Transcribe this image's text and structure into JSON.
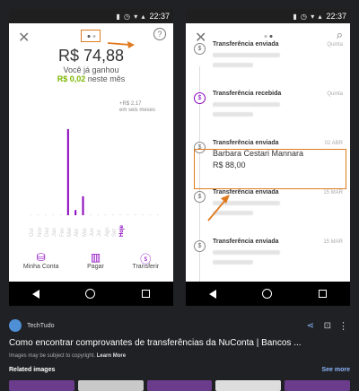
{
  "left_screen": {
    "status_time": "22:37",
    "balance": "R$ 74,88",
    "earned_line1": "Você já ganhou",
    "earned_amount": "R$ 0,02",
    "earned_line2": "neste mês",
    "chart_note": "+R$ 2,17",
    "chart_note2": "em seis meses",
    "months": [
      "Out",
      "Nov",
      "Dez",
      "Jan",
      "Fev",
      "Mar",
      "Abr",
      "Mai",
      "Jun",
      "Jul",
      "Ago",
      "Set",
      "Hoje",
      "",
      "",
      "",
      "",
      ""
    ],
    "current_month_label": "Hoje",
    "actions": [
      {
        "label": "Minha Conta",
        "icon": "account-icon"
      },
      {
        "label": "Pagar",
        "icon": "barcode-icon"
      },
      {
        "label": "Transferir",
        "icon": "transfer-icon"
      }
    ]
  },
  "right_screen": {
    "status_time": "22:37",
    "transactions": [
      {
        "title": "Transferência enviada",
        "date": "Quinta",
        "type": "sent"
      },
      {
        "title": "Transferência recebida",
        "date": "Quinta",
        "type": "received"
      },
      {
        "title": "Transferência enviada",
        "date": "02 ABR",
        "name": "Barbara Cestari Mannara",
        "amount": "R$ 88,00",
        "type": "sent"
      },
      {
        "title": "Transferência enviada",
        "date": "15 MAR",
        "type": "sent"
      },
      {
        "title": "Transferência enviada",
        "date": "15 MAR",
        "type": "sent"
      }
    ]
  },
  "result": {
    "source": "TechTudo",
    "headline": "Como encontrar comprovantes de transferências da NuConta | Bancos ...",
    "copyright_text": "Images may be subject to copyright.",
    "learn_more": "Learn More",
    "related": "Related images",
    "see_more": "See more"
  },
  "chart_data": {
    "type": "bar",
    "values": [
      0,
      0,
      0,
      0,
      0,
      100,
      6,
      22,
      0,
      0,
      0,
      0,
      0,
      0,
      0,
      0,
      0,
      0
    ],
    "highlight_color": "#8a05be"
  },
  "colors": {
    "accent": "#8a05be",
    "highlight": "#e07a1f",
    "link": "#8ab4f8"
  }
}
